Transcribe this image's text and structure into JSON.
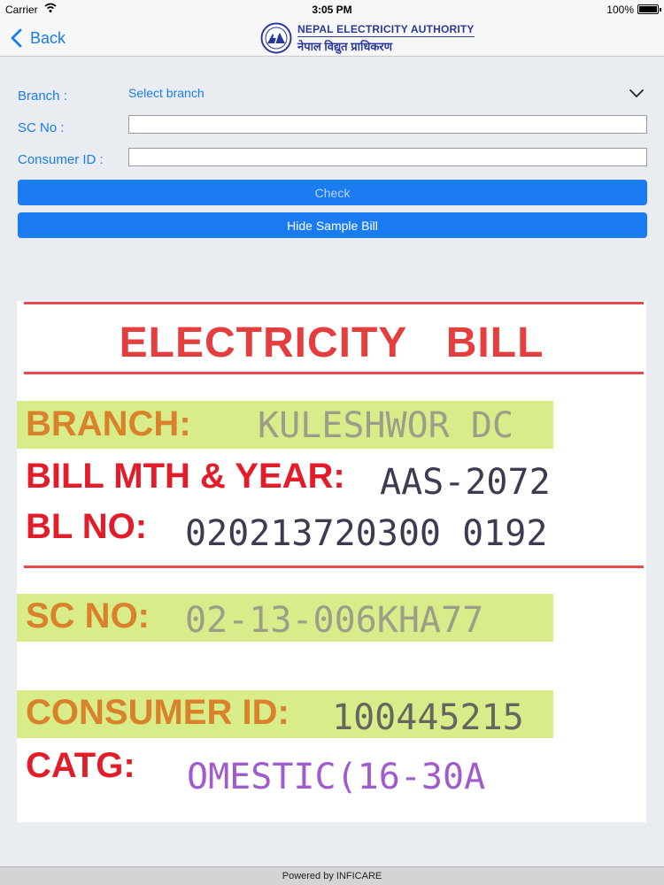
{
  "status_bar": {
    "carrier": "Carrier",
    "time": "3:05 PM",
    "battery": "100%"
  },
  "nav": {
    "back_label": "Back",
    "logo_en": "NEPAL ELECTRICITY AUTHORITY",
    "logo_np": "नेपाल विद्युत प्राधिकरण"
  },
  "form": {
    "branch_label": "Branch :",
    "branch_value": "Select branch",
    "sc_no_label": "SC No :",
    "sc_no_value": "",
    "consumer_id_label": "Consumer ID :",
    "consumer_id_value": "",
    "check_button": "Check",
    "hide_sample_button": "Hide Sample Bill"
  },
  "sample_bill": {
    "title": "ELECTRICITY BILL",
    "branch_label": "BRANCH:",
    "branch_value": "KULESHWOR DC",
    "bill_month_label": "BILL MTH & YEAR:",
    "bill_month_value": "AAS-2072",
    "bl_no_label": "BL NO:",
    "bl_no_value": "020213720300 0192",
    "sc_no_label": "SC NO:",
    "sc_no_value": "02-13-006KHA77",
    "consumer_id_label": "CONSUMER ID:",
    "consumer_id_value": "100445215",
    "catg_label": "CATG:",
    "catg_value": "OMESTIC(16-30A"
  },
  "footer": {
    "text": "Powered by INFICARE"
  },
  "colors": {
    "accent": "#1a7cf0",
    "bill_red": "#e11d2a",
    "highlight": "#d9ec8a"
  }
}
